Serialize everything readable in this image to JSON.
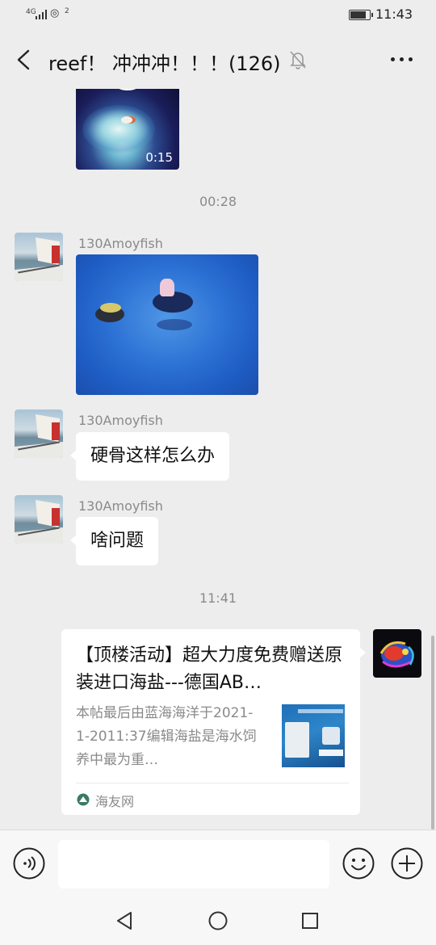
{
  "status_bar": {
    "network": "4G",
    "wifi_label": "2",
    "time": "11:43",
    "battery_percent": 85
  },
  "nav": {
    "title": "reef！ 冲冲冲！！！(126)",
    "back_icon": "chevron-left-icon",
    "mute_icon": "bell-off-icon",
    "more_icon": "ellipsis-icon"
  },
  "messages": {
    "video_duration": "0:15",
    "time_1": "00:28",
    "photo_sender": "130Amoyfish",
    "text_1_sender": "130Amoyfish",
    "text_1": "硬骨这样怎么办",
    "text_2_sender": "130Amoyfish",
    "text_2": "啥问题",
    "time_2": "11:41"
  },
  "link_card": {
    "title": "【顶楼活动】超大力度免费赠送原装进口海盐---德国AB…",
    "description": "本帖最后由蓝海海洋于2021-1-2011:37编辑海盐是海水饲养中最为重…",
    "source": "海友网"
  },
  "input_bar": {
    "voice_icon": "voice-icon",
    "input_value": "",
    "emoji_icon": "emoji-icon",
    "plus_icon": "plus-icon"
  },
  "system_nav": {
    "back_icon": "triangle-back-icon",
    "home_icon": "circle-home-icon",
    "recent_icon": "square-recent-icon"
  }
}
